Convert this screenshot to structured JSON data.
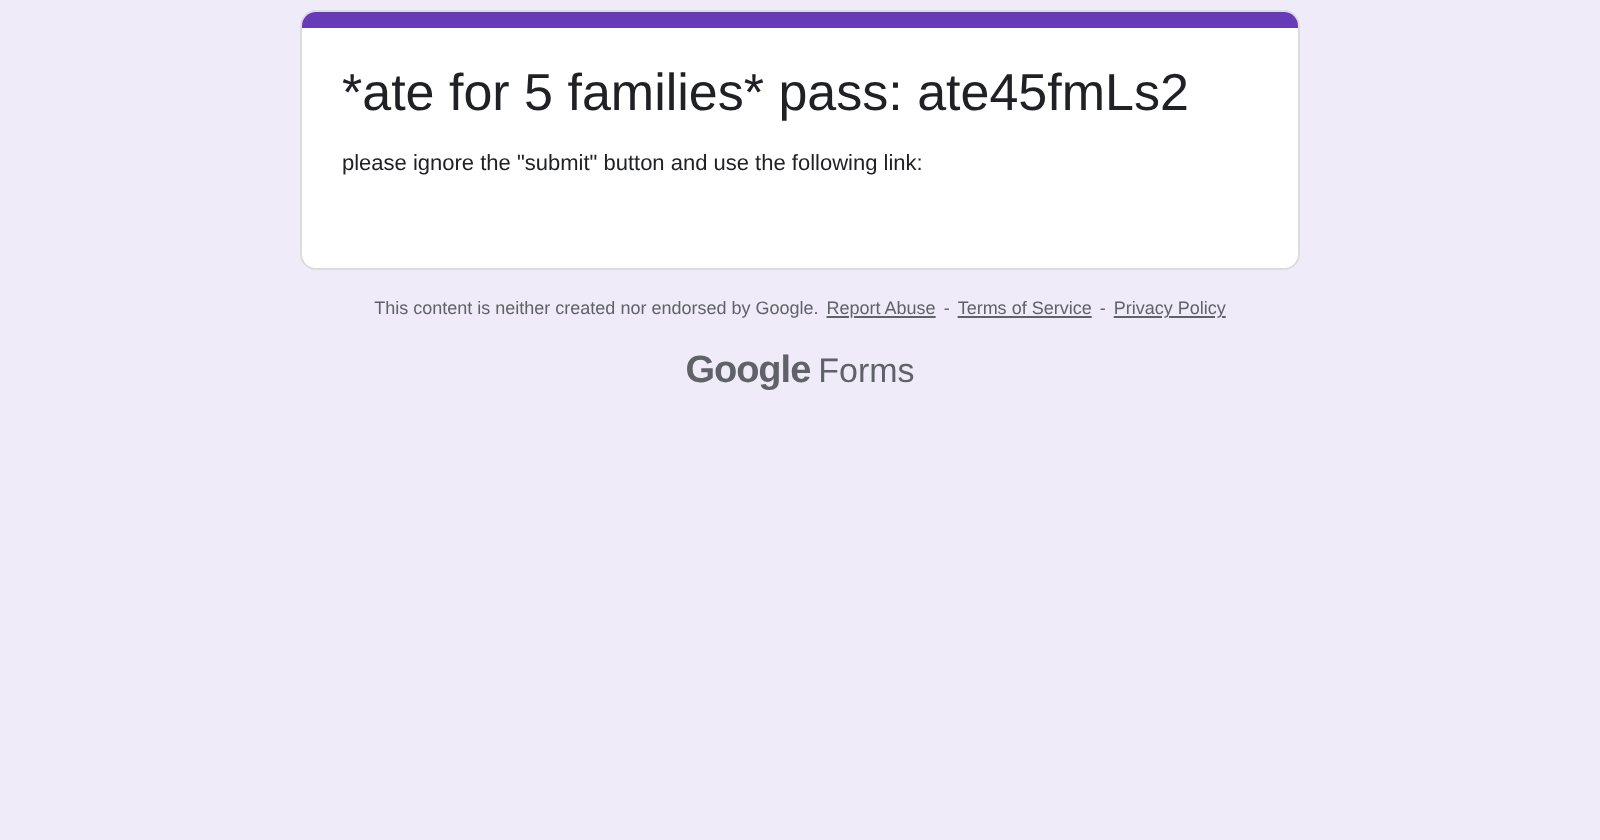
{
  "form": {
    "title": "*ate for 5 families* pass: ate45fmLs2",
    "description": "please ignore the \"submit\" button and use the following link:"
  },
  "footer": [
    {
      "kind": "text",
      "text": "This content is neither created nor endorsed by Google."
    },
    {
      "kind": "link",
      "text": "Report Abuse"
    },
    {
      "kind": "text",
      "text": "-"
    },
    {
      "kind": "link",
      "text": "Terms of Service"
    },
    {
      "kind": "text",
      "text": "-"
    },
    {
      "kind": "link",
      "text": "Privacy Policy"
    }
  ],
  "logo": {
    "brand": "Google",
    "product": "Forms"
  }
}
